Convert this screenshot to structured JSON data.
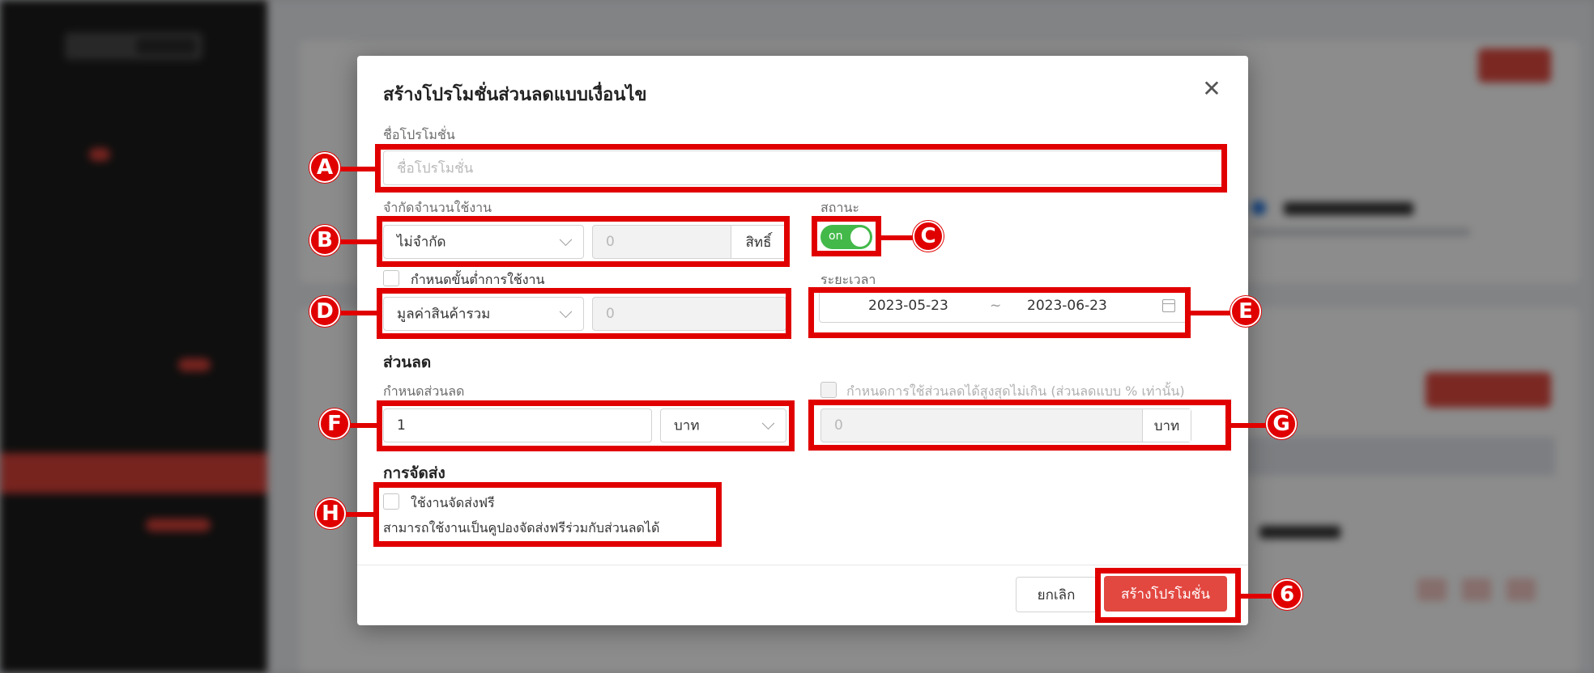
{
  "dialog": {
    "title": "สร้างโปรโมชั่นส่วนลดแบบเงื่อนไข",
    "close_glyph": "✕"
  },
  "promotion_name": {
    "label": "ชื่อโปรโมชั่น",
    "placeholder": "ชื่อโปรโมชั่น"
  },
  "usage_limit": {
    "label": "จำกัดจำนวนใช้งาน",
    "select_value": "ไม่จำกัด",
    "amount_value": "0",
    "unit": "สิทธิ์"
  },
  "status": {
    "label": "สถานะ",
    "toggle_text": "on",
    "on": true,
    "color": "#43b94a"
  },
  "minimum": {
    "checkbox_label": "กำหนดขั้นต่ำการใช้งาน",
    "checked": false,
    "select_value": "มูลค่าสินค้ารวม",
    "amount_value": "0"
  },
  "period": {
    "label": "ระยะเวลา",
    "start_date": "2023-05-23",
    "separator": "~",
    "end_date": "2023-06-23"
  },
  "discount": {
    "section_title": "ส่วนลด",
    "label": "กำหนดส่วนลด",
    "value": "1",
    "unit_select": "บาท",
    "max_checkbox_label": "กำหนดการใช้ส่วนลดได้สูงสุดไม่เกิน (ส่วนลดแบบ % เท่านั้น)",
    "max_value": "0",
    "max_unit": "บาท"
  },
  "shipping": {
    "section_title": "การจัดส่ง",
    "free_shipping_label": "ใช้งานจัดส่งฟรี",
    "checked": false,
    "helper": "สามารถใช้งานเป็นคูปองจัดส่งฟรีร่วมกับส่วนลดได้"
  },
  "footer": {
    "cancel_label": "ยกเลิก",
    "create_label": "สร้างโปรโมชั่น"
  },
  "annotations": {
    "color": "#e10000",
    "markers": [
      "A",
      "B",
      "C",
      "D",
      "E",
      "F",
      "G",
      "H",
      "6"
    ]
  },
  "colors": {
    "accent": "#e24740",
    "sidebar": "#1c1c1c"
  }
}
